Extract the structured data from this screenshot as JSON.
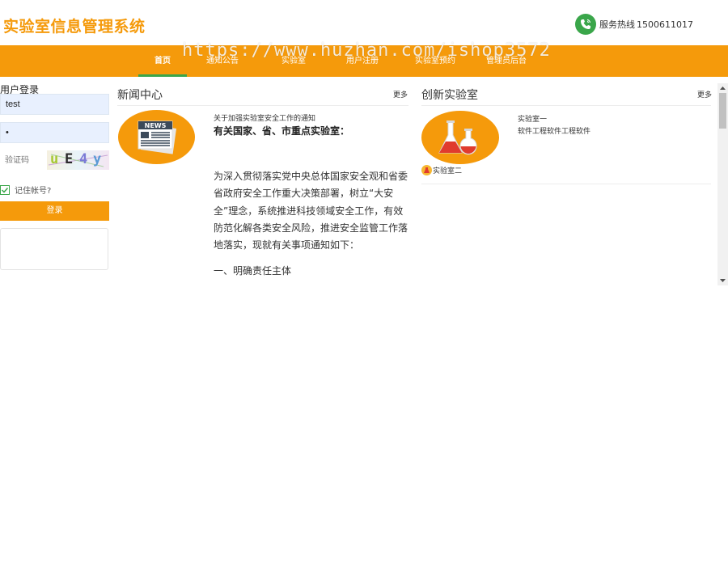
{
  "header": {
    "site_title": "实验室信息管理系统",
    "hotline_label": "服务热线",
    "hotline_number": "1500611017"
  },
  "nav": {
    "items": [
      {
        "label": "首页",
        "active": true
      },
      {
        "label": "通知公告",
        "active": false
      },
      {
        "label": "实验室",
        "active": false
      },
      {
        "label": "用户注册",
        "active": false
      },
      {
        "label": "实验室预约",
        "active": false
      },
      {
        "label": "管理员后台",
        "active": false
      }
    ]
  },
  "watermark": "https://www.huzhan.com/ishop3572",
  "login": {
    "title": "用户登录",
    "username_value": "test",
    "password_value": "•",
    "captcha_placeholder": "验证码",
    "captcha_chars": [
      "u",
      "E",
      "4",
      "y"
    ],
    "remember_label": "记住帐号?",
    "remember_checked": true,
    "login_button": "登录"
  },
  "news": {
    "title": "新闻中心",
    "more": "更多",
    "thumb_text": "NEWS",
    "headline": "关于加强实验室安全工作的通知",
    "subheading": "有关国家、省、市重点实验室：",
    "body": "为深入贯彻落实党中央总体国家安全观和省委省政府安全工作重大决策部署，树立“大安全”理念，系统推进科技领域安全工作，有效防范化解各类安全风险，推进安全监管工作落地落实，现就有关事项通知如下：",
    "point": "一、明确责任主体"
  },
  "labs": {
    "title": "创新实验室",
    "more": "更多",
    "items": [
      {
        "name": "实验室一",
        "desc": "软件工程软件工程软件"
      },
      {
        "name": "实验室二"
      }
    ]
  },
  "colors": {
    "brand_orange": "#f59a0b",
    "accent_green": "#3aa64a"
  }
}
